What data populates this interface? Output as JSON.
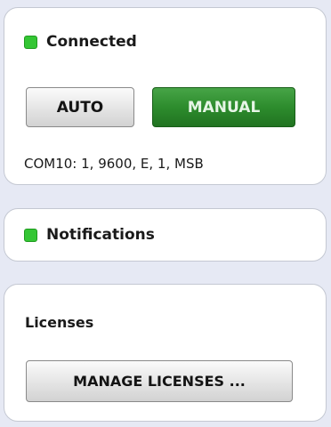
{
  "connection": {
    "status_label": "Connected",
    "status_color": "#34c634",
    "auto_label": "AUTO",
    "manual_label": "MANUAL",
    "active_mode": "MANUAL",
    "port_settings": "COM10: 1, 9600, E, 1, MSB"
  },
  "notifications": {
    "status_label": "Notifications",
    "status_color": "#34c634"
  },
  "licenses": {
    "title": "Licenses",
    "manage_label": "MANAGE LICENSES ..."
  },
  "colors": {
    "background": "#e6e9f4",
    "panel": "#ffffff",
    "manual_button": "#2d8c2d"
  },
  "icons": {
    "connection_led": "status-led-green",
    "notification_led": "status-led-green"
  }
}
